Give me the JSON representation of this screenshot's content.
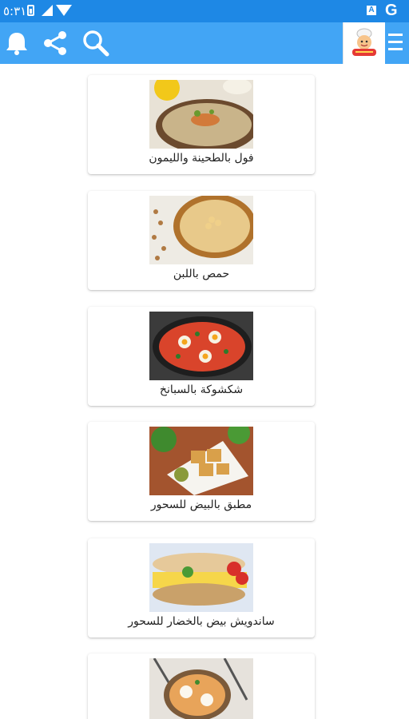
{
  "status_bar": {
    "time": "٥:٣١",
    "icons": [
      "battery-icon",
      "signal-icon",
      "wifi-icon",
      "accessibility-a-icon",
      "google-icon"
    ],
    "a_label": "A",
    "g_label": "G"
  },
  "toolbar": {
    "icons": [
      "bell-icon",
      "share-icon",
      "search-icon",
      "app-logo",
      "menu-icon"
    ],
    "colors": {
      "toolbar": "#42a5f5",
      "status_bar": "#1e88e5"
    }
  },
  "recipes": [
    {
      "title": "فول بالطحينة والليمون",
      "image": "fava-beans-tahini-photo"
    },
    {
      "title": "حمص باللبن",
      "image": "hummus-yogurt-photo"
    },
    {
      "title": "شكشوكة بالسبانخ",
      "image": "shakshuka-spinach-photo"
    },
    {
      "title": "مطبق بالبيض للسحور",
      "image": "egg-mutabbaq-photo"
    },
    {
      "title": "ساندويش بيض بالخضار للسحور",
      "image": "egg-veg-sandwich-photo"
    },
    {
      "title": "",
      "image": "egg-soup-bowl-photo"
    }
  ]
}
